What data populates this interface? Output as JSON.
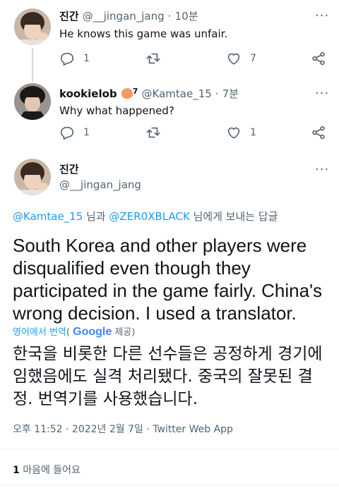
{
  "tweet1": {
    "name": "진간",
    "handle": "@__jingan_jang",
    "dot": "·",
    "time": "10분",
    "text": "He knows this game was unfair.",
    "reply_count": "1",
    "like_count": "7"
  },
  "tweet2": {
    "name": "kookielob",
    "badge": "7",
    "handle": "@Kamtae_15",
    "dot": "·",
    "time": "7분",
    "text": "Why what happened?",
    "reply_count": "1",
    "like_count": "1"
  },
  "main_tweet": {
    "name": "진간",
    "handle": "@__jingan_jang",
    "reply_to_user1": "@Kamtae_15",
    "reply_to_mid": " 님과 ",
    "reply_to_user2": "@ZER0XBLACK",
    "reply_to_suffix": " 님에게 보내는 답글",
    "text": "South Korea and other players were disqualified even though they participated in the game fairly. China's wrong decision. I used a translator.",
    "translation_prefix": "영어에서 번역",
    "translation_paren_open": "(",
    "translation_google": "Google",
    "translation_provider_suffix": " 제공)",
    "translated_text": "한국을 비롯한 다른 선수들은 공정하게 경기에 임했음에도 실격 처리됐다. 중국의 잘못된 결정. 번역기를 사용했습니다.",
    "timestamp": "오후 11:52 · 2022년 2월 7일 · Twitter Web App",
    "likes_count": "1",
    "likes_label": " 마음에 들어요"
  },
  "colors": {
    "link": "#1d9bf0",
    "muted": "#536471",
    "text": "#0f1419",
    "divider": "#eff3f4"
  }
}
